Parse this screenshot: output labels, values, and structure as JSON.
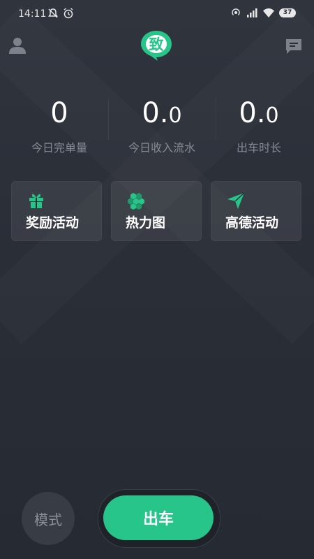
{
  "status_bar": {
    "time": "14:11",
    "battery": "37",
    "icons": [
      "notification-off-icon",
      "alarm-icon",
      "hotspot-icon",
      "signal-icon",
      "wifi-icon",
      "battery-icon"
    ]
  },
  "header": {
    "logo_text": "致",
    "logo_color": "#27c589",
    "left_icon": "user-icon",
    "right_icon": "message-icon"
  },
  "stats": [
    {
      "value_int": "0",
      "value_dec": "",
      "label": "今日完单量"
    },
    {
      "value_int": "0.",
      "value_dec": "0",
      "label": "今日收入流水"
    },
    {
      "value_int": "0.",
      "value_dec": "0",
      "label": "出车时长"
    }
  ],
  "cards": [
    {
      "label": "奖励活动",
      "icon": "gift-icon"
    },
    {
      "label": "热力图",
      "icon": "hexagon-cluster-icon"
    },
    {
      "label": "高德活动",
      "icon": "paper-plane-icon"
    }
  ],
  "bottom": {
    "mode_label": "模式",
    "go_label": "出车"
  },
  "colors": {
    "accent": "#27c589",
    "background": "#2b2f38",
    "card": "#373b44",
    "muted_text": "#858a95"
  }
}
